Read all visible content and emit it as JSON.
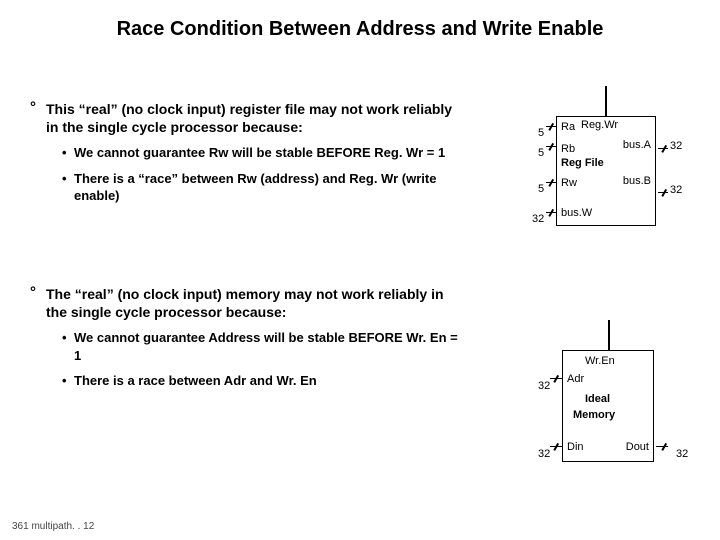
{
  "title": "Race Condition Between Address and Write Enable",
  "section1": {
    "lead": "This “real” (no clock input) register file  may not work reliably in the single cycle processor because:",
    "b1": "We cannot guarantee Rw  will be stable BEFORE Reg. Wr = 1",
    "b2": "There is a “race” between Rw (address) and Reg. Wr (write enable)"
  },
  "section2": {
    "lead": "The “real” (no clock input)  memory may not work reliably in the single cycle processor because:",
    "b1": "We cannot guarantee Address will be stable BEFORE Wr. En = 1",
    "b2": "There is a race between Adr and Wr. En"
  },
  "regfile": {
    "ra": "Ra",
    "regwr": "Reg.Wr",
    "rb": "Rb",
    "busa": "bus.A",
    "name": "Reg File",
    "rw": "Rw",
    "busb": "bus.B",
    "busw": "bus.W",
    "w5a": "5",
    "w5b": "5",
    "w5c": "5",
    "w32a": "32",
    "w32b": "32",
    "w32c": "32"
  },
  "mem": {
    "wren": "Wr.En",
    "adr": "Adr",
    "ideal": "Ideal",
    "memory": "Memory",
    "din": "Din",
    "dout": "Dout",
    "w32a": "32",
    "w32b": "32",
    "w32c": "32"
  },
  "footer": "361  multipath. . 12"
}
